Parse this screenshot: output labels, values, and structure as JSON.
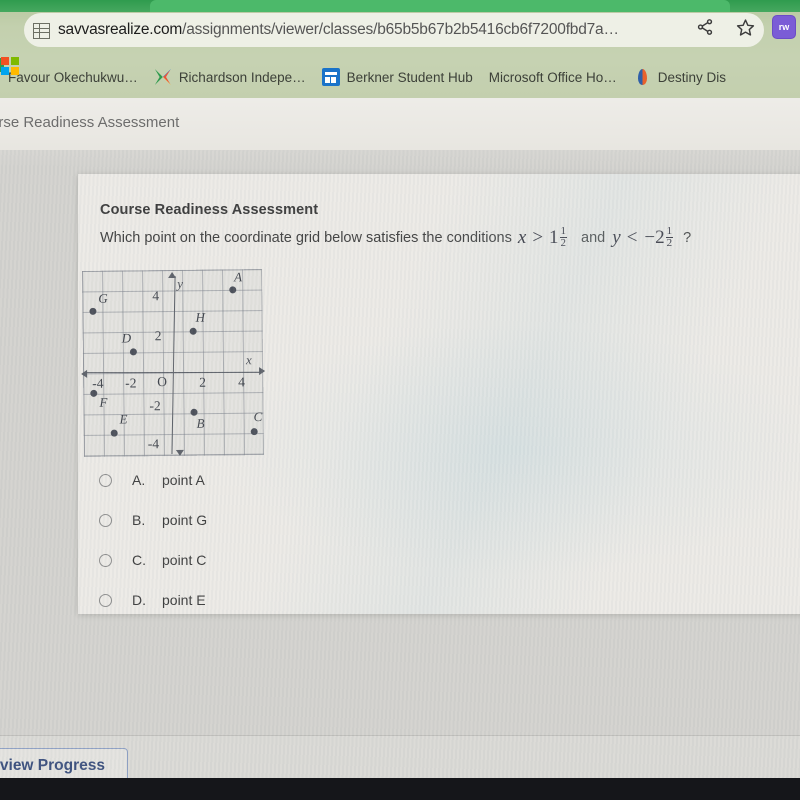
{
  "browser": {
    "url_host": "savvasrealize.com",
    "url_path": "/assignments/viewer/classes/b65b5b67b2b5416cb6f7200fbd7a…",
    "favicon_name": "site-favicon",
    "share_icon": "share-icon",
    "bookmark_star_icon": "star-icon",
    "extension_label": "rw",
    "bookmarks": [
      {
        "label": "Favour Okechukwu…",
        "icon": "bookmark-favicon-favour"
      },
      {
        "label": "Richardson Indepe…",
        "icon": "bookmark-favicon-pinwheel"
      },
      {
        "label": "Berkner Student Hub",
        "icon": "bookmark-favicon-hub"
      },
      {
        "label": "Microsoft Office Ho…",
        "icon": "bookmark-favicon-microsoft"
      },
      {
        "label": "Destiny Dis",
        "icon": "bookmark-favicon-destiny"
      }
    ]
  },
  "page_header": {
    "title": "urse Readiness Assessment"
  },
  "question": {
    "title": "Course Readiness Assessment",
    "prompt_lead": "Which point on the coordinate grid below satisfies the conditions",
    "var_x": "x",
    "op_gt": ">",
    "x_whole": "1",
    "x_num": "1",
    "x_den": "2",
    "conj": "and",
    "var_y": "y",
    "op_lt": "<",
    "y_sign": "−2",
    "y_num": "1",
    "y_den": "2",
    "question_mark": "?"
  },
  "chart_data": {
    "type": "scatter",
    "title": "",
    "xlabel": "x",
    "ylabel": "y",
    "xlim": [
      -5,
      5
    ],
    "ylim": [
      -5,
      5
    ],
    "grid": true,
    "x_ticks": [
      "-4",
      "-2",
      "2",
      "4"
    ],
    "y_ticks": [
      "4",
      "2",
      "-2",
      "-4"
    ],
    "origin_label": "O",
    "points": [
      {
        "label": "A",
        "x": 3,
        "y": 4
      },
      {
        "label": "G",
        "x": -4,
        "y": 3
      },
      {
        "label": "H",
        "x": 1,
        "y": 2
      },
      {
        "label": "D",
        "x": -2,
        "y": 1
      },
      {
        "label": "F",
        "x": -4,
        "y": -1
      },
      {
        "label": "B",
        "x": 1,
        "y": -2
      },
      {
        "label": "E",
        "x": -3,
        "y": -3
      },
      {
        "label": "C",
        "x": 4,
        "y": -3
      }
    ]
  },
  "options": [
    {
      "letter": "A.",
      "text": "point A",
      "selected": false
    },
    {
      "letter": "B.",
      "text": "point G",
      "selected": false
    },
    {
      "letter": "C.",
      "text": "point C",
      "selected": false
    },
    {
      "letter": "D.",
      "text": "point E",
      "selected": false
    }
  ],
  "footer": {
    "review_button": "eview Progress"
  },
  "colors": {
    "chrome_green": "#c3d0ae",
    "tab_green": "#46a85f",
    "card_bg": "#eceae6",
    "button_blue": "#3b4f7d"
  }
}
